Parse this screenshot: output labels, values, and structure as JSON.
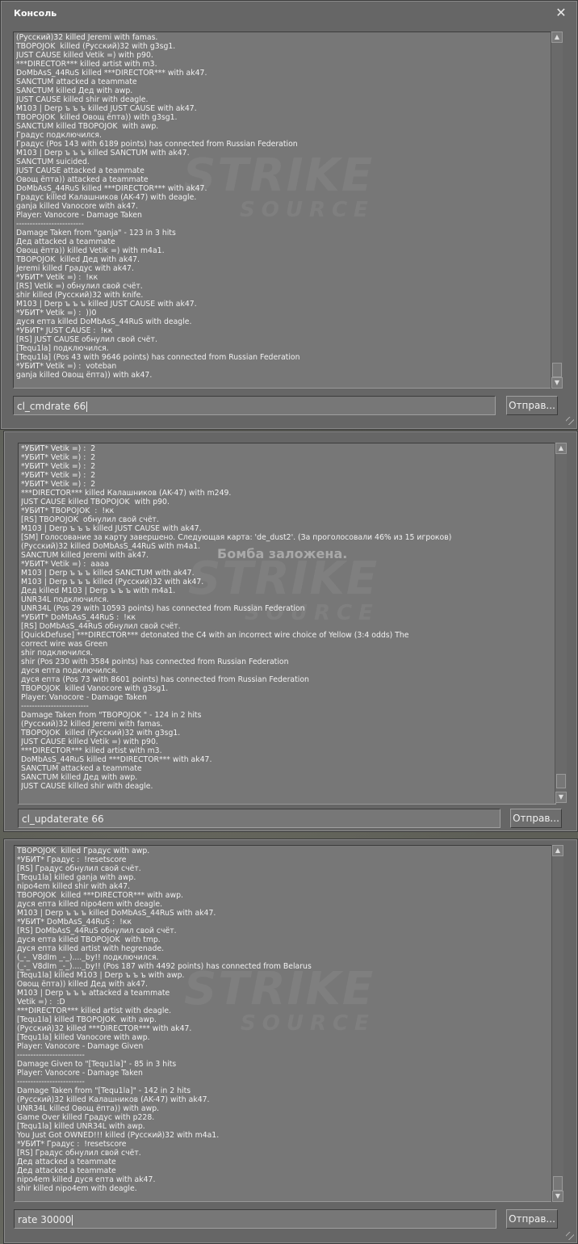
{
  "panels": [
    {
      "title": "Консоль",
      "close_icon": "close-icon",
      "watermark": {
        "big": "STRIKE",
        "small": "SOURCE"
      },
      "lines": [
        "(Русский)32 killed Jeremi with famas.",
        "ТВОРОJOK  killed (Русский)32 with g3sg1.",
        "JUST CAUSE killed Vetik =) with p90.",
        "***DIRECTOR*** killed artist with m3.",
        "DoMbAsS_44RuS killed ***DIRECTOR*** with ak47.",
        "SANCTUM attacked a teammate",
        "SANCTUM killed Дед with awp.",
        "JUST CAUSE killed shir with deagle.",
        "M103 | Derp ъ ъ ъ killed JUST CAUSE with ak47.",
        "ТВОРОJOK  killed Овощ ёпта)) with g3sg1.",
        "SANCTUM killed ТВОРОJOK  with awp.",
        "Градус подключился.",
        "Градус (Pos 143 with 6189 points) has connected from Russian Federation",
        "M103 | Derp ъ ъ ъ killed SANCTUM with ak47.",
        "SANCTUM suicided.",
        "JUST CAUSE attacked a teammate",
        "Овощ ёпта)) attacked a teammate",
        "DoMbAsS_44RuS killed ***DIRECTOR*** with ak47.",
        "Градус killed Калашников (AK-47) with deagle.",
        "ganja killed Vanocore with ak47.",
        "Player: Vanocore - Damage Taken",
        "-------------------------",
        "Damage Taken from \"ganja\" - 123 in 3 hits",
        "Дед attacked a teammate",
        "Овощ ёпта)) killed Vetik =) with m4a1.",
        "ТВОРОJOK  killed Дед with ak47.",
        "Jeremi killed Градус with ak47.",
        "*УБИТ* Vetik =) :  !кк",
        "[RS] Vetik =) обнулил свой счёт.",
        "shir killed (Русский)32 with knife.",
        "M103 | Derp ъ ъ ъ killed JUST CAUSE with ak47.",
        "*УБИТ* Vetik =) :  ))0",
        "дуся епта killed DoMbAsS_44RuS with deagle.",
        "*УБИТ* JUST CAUSE :  !кк",
        "[RS] JUST CAUSE обнулил свой счёт.",
        "[Tequ1la] подключился.",
        "[Tequ1la] (Pos 43 with 9646 points) has connected from Russian Federation",
        "*УБИТ* Vetik =) :  voteban",
        "ganja killed Овощ ёпта)) with ak47."
      ],
      "input_value": "cl_cmdrate 66",
      "send_label": "Отправ..."
    },
    {
      "title": "",
      "watermark": {
        "big": "STRIKE",
        "small": "SOURCE"
      },
      "overlay_text": "Бомба заложена.",
      "lines": [
        "*УБИТ* Vetik =) :  2",
        "*УБИТ* Vetik =) :  2",
        "*УБИТ* Vetik =) :  2",
        "*УБИТ* Vetik =) :  2",
        "*УБИТ* Vetik =) :  2",
        "***DIRECTOR*** killed Калашников (AK-47) with m249.",
        "JUST CAUSE killed ТВОРОJOK  with p90.",
        "*УБИТ* ТВОРОJOK  :  !кк",
        "[RS] ТВОРОJOK  обнулил свой счёт.",
        "M103 | Derp ъ ъ ъ killed JUST CAUSE with ak47.",
        "[SM] Голосование за карту завершено. Следующая карта: 'de_dust2'. (За проголосовали 46% из 15 игроков)",
        "(Русский)32 killed DoMbAsS_44RuS with m4a1.",
        "SANCTUM killed Jeremi with ak47.",
        "*УБИТ* Vetik =) :  аааа",
        "M103 | Derp ъ ъ ъ killed SANCTUM with ak47.",
        "M103 | Derp ъ ъ ъ killed (Русский)32 with ak47.",
        "Дед killed M103 | Derp ъ ъ ъ with m4a1.",
        "UNR34L подключился.",
        "UNR34L (Pos 29 with 10593 points) has connected from Russian Federation",
        "*УБИТ* DoMbAsS_44RuS :  !кк",
        "[RS] DoMbAsS_44RuS обнулил свой счёт.",
        "[QuickDefuse] ***DIRECTOR*** detonated the C4 with an incorrect wire choice of Yellow (3:4 odds) The",
        "correct wire was Green",
        "shir подключился.",
        "shir (Pos 230 with 3584 points) has connected from Russian Federation",
        "дуся епта подключился.",
        "дуся епта (Pos 73 with 8601 points) has connected from Russian Federation",
        "ТВОРОJOK  killed Vanocore with g3sg1.",
        "Player: Vanocore - Damage Taken",
        "-------------------------",
        "Damage Taken from \"ТВОРОJOK \" - 124 in 2 hits",
        "(Русский)32 killed Jeremi with famas.",
        "ТВОРОJOK  killed (Русский)32 with g3sg1.",
        "JUST CAUSE killed Vetik =) with p90.",
        "***DIRECTOR*** killed artist with m3.",
        "DoMbAsS_44RuS killed ***DIRECTOR*** with ak47.",
        "SANCTUM attacked a teammate",
        "SANCTUM killed Дед with awp.",
        "JUST CAUSE killed shir with deagle."
      ],
      "input_value": "cl_updaterate 66",
      "send_label": "Отправ..."
    },
    {
      "title": "",
      "watermark": {
        "big": "STRIKE",
        "small": "SOURCE"
      },
      "lines": [
        "ТВОРОJOK  killed Градус with awp.",
        "*УБИТ* Градус :  !resetscore",
        "[RS] Градус обнулил свой счёт.",
        "[Tequ1la] killed ganja with awp.",
        "nipo4em killed shir with ak47.",
        "ТВОРОJOK  killed ***DIRECTOR*** with awp.",
        "дуся епта killed nipo4em with deagle.",
        "M103 | Derp ъ ъ ъ killed DoMbAsS_44RuS with ak47.",
        "*УБИТ* DoMbAsS_44RuS :  !кк",
        "[RS] DoMbAsS_44RuS обнулил свой счёт.",
        "дуся епта killed ТВОРОJOK  with tmp.",
        "дуся епта killed artist with hegrenade.",
        "(_-_ V8dIm _-_)...._by!! подключился.",
        "(_-_ V8dIm _-_)...._by!! (Pos 187 with 4492 points) has connected from Belarus",
        "[Tequ1la] killed M103 | Derp ъ ъ ъ with awp.",
        "Овощ ёпта)) killed Дед with ak47.",
        "M103 | Derp ъ ъ ъ attacked a teammate",
        "Vetik =) :  :D",
        "***DIRECTOR*** killed artist with deagle.",
        "[Tequ1la] killed ТВОРОJOK  with awp.",
        "(Русский)32 killed ***DIRECTOR*** with ak47.",
        "[Tequ1la] killed Vanocore with awp.",
        "Player: Vanocore - Damage Given",
        "-------------------------",
        "Damage Given to \"[Tequ1la]\" - 85 in 3 hits",
        "Player: Vanocore - Damage Taken",
        "-------------------------",
        "Damage Taken from \"[Tequ1la]\" - 142 in 2 hits",
        "(Русский)32 killed Калашников (AK-47) with ak47.",
        "UNR34L killed Овощ ёпта)) with awp.",
        "Game Over killed Градус with p228.",
        "[Tequ1la] killed UNR34L with awp.",
        "You Just Got OWNED!!! killed (Русский)32 with m4a1.",
        "*УБИТ* Градус :  !resetscore",
        "[RS] Градус обнулил свой счёт.",
        "Дед attacked a teammate",
        "Дед attacked a teammate",
        "nipo4em killed дуся епта with ak47.",
        "shir killed nipo4em with deagle."
      ],
      "input_value": "rate 30000",
      "send_label": "Отправ..."
    }
  ]
}
